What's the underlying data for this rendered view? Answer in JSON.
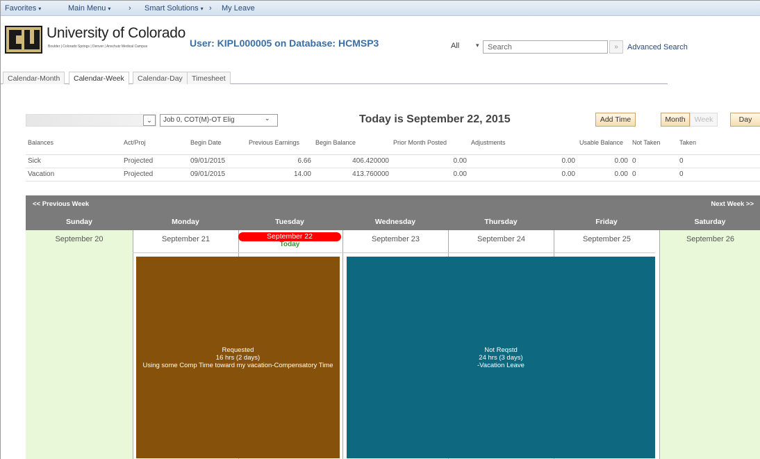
{
  "nav": {
    "favorites": "Favorites",
    "main_menu": "Main Menu",
    "sep1": "›",
    "smart_solutions": "Smart Solutions",
    "sep2": "›",
    "my_leave": "My Leave"
  },
  "header": {
    "university": "University of Colorado",
    "campuses": "Boulder | Colorado Springs | Denver | Anschutz Medical Campus",
    "user_line": "User: KIPL000005 on Database: HCMSP3",
    "search_scope": "All",
    "search_placeholder": "Search",
    "search_go": "»",
    "advanced_search": "Advanced Search"
  },
  "tabs": [
    "Calendar-Month",
    "Calendar-Week",
    "Calendar-Day",
    "Timesheet"
  ],
  "active_tab": "Calendar-Week",
  "controls": {
    "job": "Job 0, COT(M)-OT Elig",
    "today": "Today is September 22, 2015",
    "add_time": "Add Time",
    "month": "Month",
    "week": "Week",
    "day": "Day"
  },
  "balances": {
    "headers": [
      "Balances",
      "Act/Proj",
      "Begin Date",
      "Previous Earnings",
      "Begin Balance",
      "Prior Month Posted",
      "Adjustments",
      "Usable Balance",
      "Not Taken",
      "Taken"
    ],
    "rows": [
      [
        "Sick",
        "Projected",
        "09/01/2015",
        "6.66",
        "406.420000",
        "0.00",
        "0.00",
        "0.00",
        "0",
        "0"
      ],
      [
        "Vacation",
        "Projected",
        "09/01/2015",
        "14.00",
        "413.760000",
        "0.00",
        "0.00",
        "0.00",
        "0",
        "0"
      ]
    ]
  },
  "calendar": {
    "prev_week": "<< Previous Week",
    "next_week": "Next Week >>",
    "days": [
      "Sunday",
      "Monday",
      "Tuesday",
      "Wednesday",
      "Thursday",
      "Friday",
      "Saturday"
    ],
    "dates": [
      "September 20",
      "September 21",
      "September 22",
      "September 23",
      "September 24",
      "September 25",
      "September 26"
    ],
    "today_label": "Today",
    "events": [
      {
        "line1": "Requested",
        "line2": "16 hrs (2 days)",
        "line3": "Using some Comp Time toward my vacation-Compensatory Time",
        "color": "#85510b"
      },
      {
        "line1": "Not Reqstd",
        "line2": "24 hrs (3 days)",
        "line3": "-Vacation Leave",
        "color": "#0d6880"
      }
    ]
  },
  "colors": {
    "today_pill": "#ff0000",
    "weekend": "#e8f8d8",
    "header_bar": "#7b7b7b"
  }
}
